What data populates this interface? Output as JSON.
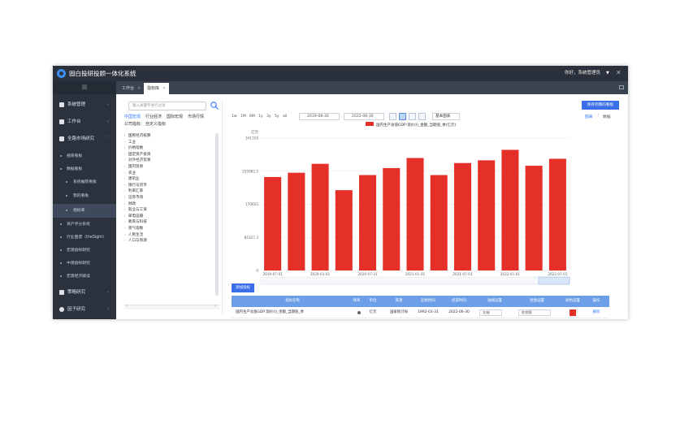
{
  "app": {
    "title": "固白投研投顾一体化系统",
    "greeting": "你好，系统管理员",
    "caret": "▼",
    "close": "✕"
  },
  "nav": {
    "collapse": "|||",
    "items": [
      {
        "label": "系统管理",
        "arrow": "‹"
      },
      {
        "label": "工作台",
        "arrow": "‹"
      },
      {
        "label": "全路市场研究",
        "arrow": "ˇ"
      }
    ],
    "sub": [
      {
        "label": "投研看板",
        "deep": false
      },
      {
        "label": "数据看板",
        "deep": false
      },
      {
        "label": "系统推荐看板",
        "deep": true
      },
      {
        "label": "我的看板",
        "deep": true
      },
      {
        "label": "指标库",
        "deep": true
      },
      {
        "label": "资产评分系统",
        "deep": false
      },
      {
        "label": "行业图谱（theSight）",
        "deep": false
      },
      {
        "label": "宏观指标研究",
        "deep": false
      },
      {
        "label": "中观指标研究",
        "deep": false
      },
      {
        "label": "宏观经济解读",
        "deep": false
      }
    ],
    "bottom": [
      {
        "label": "策略研究",
        "arrow": "‹"
      },
      {
        "label": "因子研究",
        "arrow": "‹"
      }
    ]
  },
  "tabs": [
    {
      "label": "工作台",
      "close": "×"
    },
    {
      "label": "指标库",
      "close": "×"
    }
  ],
  "tree": {
    "search_placeholder": "输入关键字进行过滤",
    "categories": [
      "中国宏观",
      "行业经济",
      "国际宏观",
      "市场行情",
      "公司指标",
      "自定义指标"
    ],
    "items": [
      "国民经济核算",
      "工业",
      "价格指数",
      "固定资产投资",
      "对外经济贸易",
      "国内贸易",
      "农业",
      "建筑业",
      "银行与货币",
      "利率汇率",
      "证券市场",
      "财政",
      "就业与工资",
      "邮电运输",
      "教育与科技",
      "景气指数",
      "人民生活",
      "人口与资源"
    ],
    "caret": "›"
  },
  "toolbar": {
    "ranges": [
      "1w",
      "1M",
      "6M",
      "1y",
      "3y",
      "5y",
      "all"
    ],
    "date_from": "2019-08-30",
    "date_to": "2022-06-30",
    "chart_type": "基本图表",
    "save_label": "保存到我的看板",
    "view_chart": "图表",
    "view_sep": "|",
    "view_data": "数据",
    "add_series": "添加指标"
  },
  "chart_data": {
    "type": "bar",
    "ylabel": "亿元",
    "legend": "国内生产总值GDP:现价(I)_金额_当期值_季(亿元)",
    "series_color": "#e5302a",
    "yticks": [
      0,
      85327.3,
      170655,
      255982.5,
      341310
    ],
    "ylim": [
      0,
      341310
    ],
    "xticks": [
      "2019-07-01",
      "2020-01-01",
      "2020-07-31",
      "2021-01-01",
      "2021-07-01",
      "2022-01-01",
      "2022-07-01"
    ],
    "values": [
      241000,
      252000,
      275000,
      207000,
      246000,
      264000,
      290000,
      246000,
      277000,
      284000,
      311000,
      270000,
      288000
    ]
  },
  "table": {
    "headers": [
      "指标名称",
      "频率",
      "单位",
      "来源",
      "起始时间",
      "结束时间",
      "轴线设置",
      "绘图设置",
      "颜色设置",
      "操作"
    ],
    "row": {
      "name": "国内生产总值GDP:现价(I)_金额_当期值_季",
      "freq_marker": "●",
      "unit": "亿元",
      "source": "国家统计局",
      "start": "1992-03-31",
      "end": "2022-06-30",
      "axis": "左轴",
      "draw": "柱状图",
      "action": "删除"
    }
  }
}
